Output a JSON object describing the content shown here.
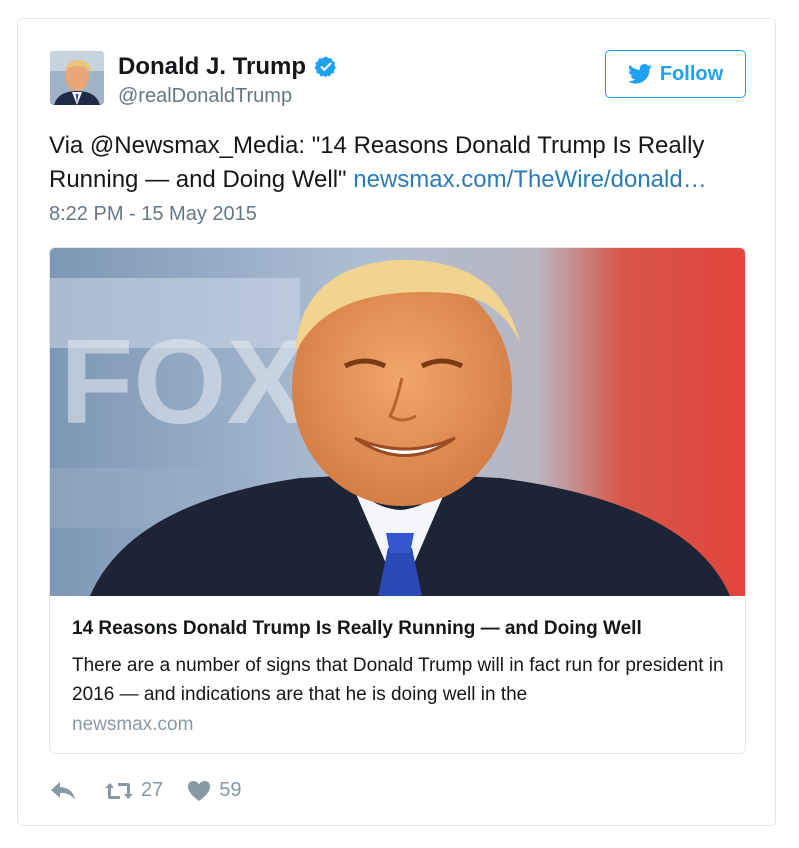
{
  "author": {
    "display_name": "Donald J. Trump",
    "handle": "@realDonaldTrump",
    "verified_icon": "verified-badge-icon",
    "avatar_icon": "profile-photo"
  },
  "follow_button": {
    "label": "Follow",
    "icon": "twitter-bird-icon"
  },
  "tweet": {
    "text_prefix": "Via @Newsmax_Media: \"14 Reasons Donald Trump Is Really Running — and Doing Well\" ",
    "link_text": "newsmax.com/TheWire/donald…",
    "timestamp": "8:22 PM - 15 May 2015"
  },
  "link_card": {
    "image_icon": "article-photo",
    "title": "14 Reasons Donald Trump Is Really Running — and Doing Well",
    "description": "There are a number of signs that Donald Trump will in fact run for president in 2016 — and indications are that he is doing well in the",
    "domain": "newsmax.com"
  },
  "actions": {
    "reply_icon": "reply-icon",
    "retweet_icon": "retweet-icon",
    "retweet_count": "27",
    "like_icon": "heart-icon",
    "like_count": "59"
  },
  "colors": {
    "brand_blue": "#1da1f2",
    "link_blue": "#2b7bb9",
    "secondary_text": "#657786",
    "action_gray": "#8899a6",
    "border": "#e1e8ed"
  }
}
